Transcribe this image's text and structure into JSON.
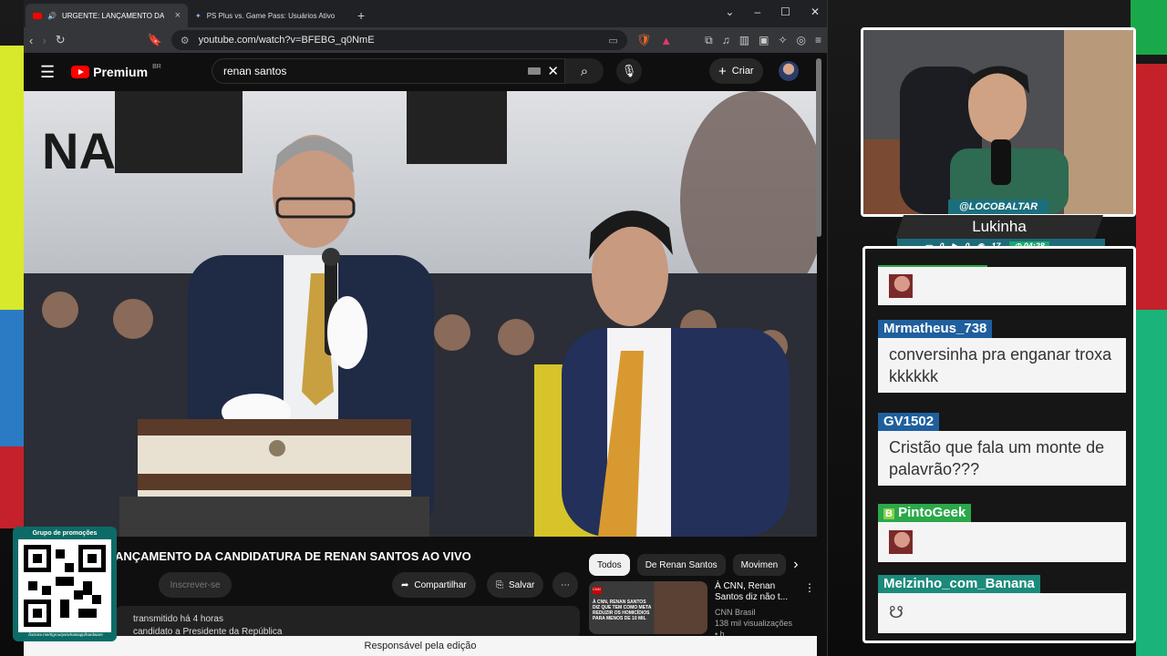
{
  "browser": {
    "tabs": [
      {
        "title": "URGENTE: LANÇAMENTO DA CAND",
        "active": true,
        "icon": "youtube-icon"
      },
      {
        "title": "PS Plus vs. Game Pass: Usuários Ativos - Goo",
        "active": false,
        "icon": "gemini-icon"
      }
    ],
    "url": "youtube.com/watch?v=BFEBG_q0NmE"
  },
  "youtube": {
    "logo_text": "Premium",
    "region": "BR",
    "search_value": "renan santos",
    "create_label": "Criar",
    "video_title": "ANÇAMENTO DA CANDIDATURA DE RENAN SANTOS AO VIVO",
    "subscribe_label": "Inscrever-se",
    "share_label": "Compartilhar",
    "save_label": "Salvar",
    "desc_line1": "transmitido há 4 horas",
    "desc_line2": "candidato a Presidente da República",
    "chips": [
      "Todos",
      "De Renan Santos",
      "Movimen"
    ],
    "rec_title_1": "À CNN, Renan",
    "rec_title_2": "Santos diz não t...",
    "rec_channel": "CNN Brasil",
    "rec_views": "138 mil visualizações • h...",
    "rec_thumb_text": "À CNN, RENAN SANTOS DIZ QUE TEM COMO META REDUZIR OS HOMICÍDIOS PARA MENOS DE 10 MIL",
    "banner": "Responsável pela edição"
  },
  "stream": {
    "handle": "@LOCOBALTAR",
    "name": "Lukinha",
    "stat1": "0",
    "stat2": "0",
    "stat3": "17",
    "time": "04:28",
    "qr_title": "Grupo de promoções",
    "qr_url": "/loctore.me/t/grou/ps/whatsapp/hardware"
  },
  "chat": [
    {
      "user": "",
      "text": "",
      "emote": true
    },
    {
      "user": "Mrmatheus_738",
      "text": "conversinha pra enganar troxa kkkkkk",
      "color": "#1f5f9e"
    },
    {
      "user": "GV1502",
      "text": "Cristão que fala um monte de palavrão???",
      "color": "#1f5f9e"
    },
    {
      "user": "PintoGeek",
      "text": "",
      "color": "#2aa84a",
      "emote": true
    },
    {
      "user": "Melzinho_com_Banana",
      "text": "",
      "color": "#1c8a7a",
      "emote": true
    }
  ]
}
